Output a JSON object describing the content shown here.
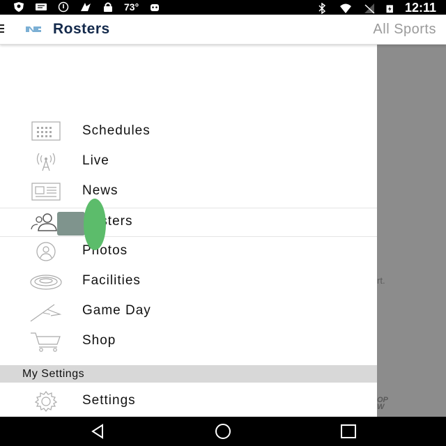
{
  "status_bar": {
    "temperature": "73°",
    "time": "12:11"
  },
  "app_bar": {
    "title": "Rosters",
    "right_action": "All Sports"
  },
  "drawer": {
    "items": [
      {
        "label": "Schedules",
        "icon": "calendar-icon"
      },
      {
        "label": "Live",
        "icon": "broadcast-icon"
      },
      {
        "label": "News",
        "icon": "newspaper-icon"
      },
      {
        "label": "Rosters",
        "icon": "people-icon",
        "selected": true
      },
      {
        "label": "Photos",
        "icon": "person-circle-icon"
      },
      {
        "label": "Facilities",
        "icon": "stadium-icon"
      },
      {
        "label": "Game Day",
        "icon": "pennant-icon"
      },
      {
        "label": "Shop",
        "icon": "cart-icon"
      }
    ],
    "section_header": "My Settings",
    "settings_item": {
      "label": "Settings",
      "icon": "gear-icon"
    }
  },
  "background": {
    "partial_text": "rt.",
    "partial_logo_text": "OP\nW"
  },
  "colors": {
    "brand_navy": "#13294b",
    "brand_light_blue": "#7bafd4",
    "overlay_gray": "#8c8c8c",
    "section_gray": "#d8d8d8",
    "touch_indicator_green": "#5cbc6b"
  }
}
